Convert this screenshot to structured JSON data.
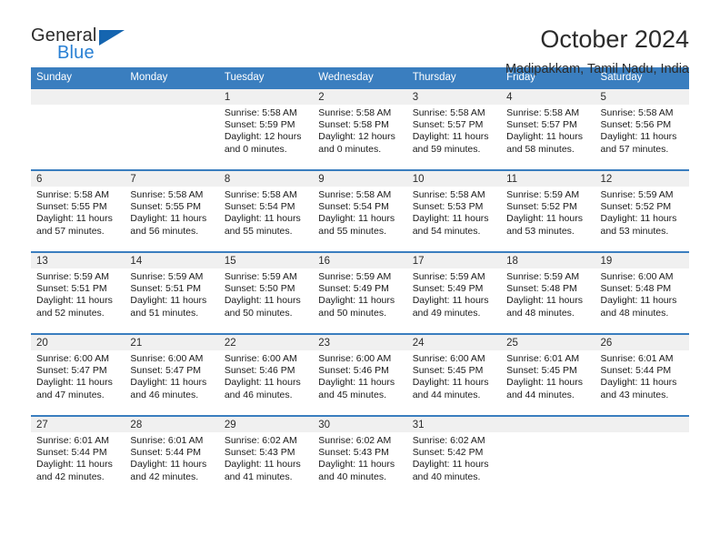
{
  "brand": {
    "name_part1": "General",
    "name_part2": "Blue",
    "triangle_color": "#1565b0",
    "blue_text_color": "#2980d4"
  },
  "header": {
    "title": "October 2024",
    "subtitle": "Madipakkam, Tamil Nadu, India"
  },
  "theme": {
    "header_row_bg": "#3a7ebf",
    "header_row_text": "#ffffff",
    "daynum_bg": "#f0f0f0",
    "grid_line": "#3a7ebf"
  },
  "weekday_headers": [
    "Sunday",
    "Monday",
    "Tuesday",
    "Wednesday",
    "Thursday",
    "Friday",
    "Saturday"
  ],
  "weeks": [
    [
      {
        "day": "",
        "sunrise": "",
        "sunset": "",
        "daylight": "",
        "empty": true
      },
      {
        "day": "",
        "sunrise": "",
        "sunset": "",
        "daylight": "",
        "empty": true
      },
      {
        "day": "1",
        "sunrise": "Sunrise: 5:58 AM",
        "sunset": "Sunset: 5:59 PM",
        "daylight": "Daylight: 12 hours and 0 minutes."
      },
      {
        "day": "2",
        "sunrise": "Sunrise: 5:58 AM",
        "sunset": "Sunset: 5:58 PM",
        "daylight": "Daylight: 12 hours and 0 minutes."
      },
      {
        "day": "3",
        "sunrise": "Sunrise: 5:58 AM",
        "sunset": "Sunset: 5:57 PM",
        "daylight": "Daylight: 11 hours and 59 minutes."
      },
      {
        "day": "4",
        "sunrise": "Sunrise: 5:58 AM",
        "sunset": "Sunset: 5:57 PM",
        "daylight": "Daylight: 11 hours and 58 minutes."
      },
      {
        "day": "5",
        "sunrise": "Sunrise: 5:58 AM",
        "sunset": "Sunset: 5:56 PM",
        "daylight": "Daylight: 11 hours and 57 minutes."
      }
    ],
    [
      {
        "day": "6",
        "sunrise": "Sunrise: 5:58 AM",
        "sunset": "Sunset: 5:55 PM",
        "daylight": "Daylight: 11 hours and 57 minutes."
      },
      {
        "day": "7",
        "sunrise": "Sunrise: 5:58 AM",
        "sunset": "Sunset: 5:55 PM",
        "daylight": "Daylight: 11 hours and 56 minutes."
      },
      {
        "day": "8",
        "sunrise": "Sunrise: 5:58 AM",
        "sunset": "Sunset: 5:54 PM",
        "daylight": "Daylight: 11 hours and 55 minutes."
      },
      {
        "day": "9",
        "sunrise": "Sunrise: 5:58 AM",
        "sunset": "Sunset: 5:54 PM",
        "daylight": "Daylight: 11 hours and 55 minutes."
      },
      {
        "day": "10",
        "sunrise": "Sunrise: 5:58 AM",
        "sunset": "Sunset: 5:53 PM",
        "daylight": "Daylight: 11 hours and 54 minutes."
      },
      {
        "day": "11",
        "sunrise": "Sunrise: 5:59 AM",
        "sunset": "Sunset: 5:52 PM",
        "daylight": "Daylight: 11 hours and 53 minutes."
      },
      {
        "day": "12",
        "sunrise": "Sunrise: 5:59 AM",
        "sunset": "Sunset: 5:52 PM",
        "daylight": "Daylight: 11 hours and 53 minutes."
      }
    ],
    [
      {
        "day": "13",
        "sunrise": "Sunrise: 5:59 AM",
        "sunset": "Sunset: 5:51 PM",
        "daylight": "Daylight: 11 hours and 52 minutes."
      },
      {
        "day": "14",
        "sunrise": "Sunrise: 5:59 AM",
        "sunset": "Sunset: 5:51 PM",
        "daylight": "Daylight: 11 hours and 51 minutes."
      },
      {
        "day": "15",
        "sunrise": "Sunrise: 5:59 AM",
        "sunset": "Sunset: 5:50 PM",
        "daylight": "Daylight: 11 hours and 50 minutes."
      },
      {
        "day": "16",
        "sunrise": "Sunrise: 5:59 AM",
        "sunset": "Sunset: 5:49 PM",
        "daylight": "Daylight: 11 hours and 50 minutes."
      },
      {
        "day": "17",
        "sunrise": "Sunrise: 5:59 AM",
        "sunset": "Sunset: 5:49 PM",
        "daylight": "Daylight: 11 hours and 49 minutes."
      },
      {
        "day": "18",
        "sunrise": "Sunrise: 5:59 AM",
        "sunset": "Sunset: 5:48 PM",
        "daylight": "Daylight: 11 hours and 48 minutes."
      },
      {
        "day": "19",
        "sunrise": "Sunrise: 6:00 AM",
        "sunset": "Sunset: 5:48 PM",
        "daylight": "Daylight: 11 hours and 48 minutes."
      }
    ],
    [
      {
        "day": "20",
        "sunrise": "Sunrise: 6:00 AM",
        "sunset": "Sunset: 5:47 PM",
        "daylight": "Daylight: 11 hours and 47 minutes."
      },
      {
        "day": "21",
        "sunrise": "Sunrise: 6:00 AM",
        "sunset": "Sunset: 5:47 PM",
        "daylight": "Daylight: 11 hours and 46 minutes."
      },
      {
        "day": "22",
        "sunrise": "Sunrise: 6:00 AM",
        "sunset": "Sunset: 5:46 PM",
        "daylight": "Daylight: 11 hours and 46 minutes."
      },
      {
        "day": "23",
        "sunrise": "Sunrise: 6:00 AM",
        "sunset": "Sunset: 5:46 PM",
        "daylight": "Daylight: 11 hours and 45 minutes."
      },
      {
        "day": "24",
        "sunrise": "Sunrise: 6:00 AM",
        "sunset": "Sunset: 5:45 PM",
        "daylight": "Daylight: 11 hours and 44 minutes."
      },
      {
        "day": "25",
        "sunrise": "Sunrise: 6:01 AM",
        "sunset": "Sunset: 5:45 PM",
        "daylight": "Daylight: 11 hours and 44 minutes."
      },
      {
        "day": "26",
        "sunrise": "Sunrise: 6:01 AM",
        "sunset": "Sunset: 5:44 PM",
        "daylight": "Daylight: 11 hours and 43 minutes."
      }
    ],
    [
      {
        "day": "27",
        "sunrise": "Sunrise: 6:01 AM",
        "sunset": "Sunset: 5:44 PM",
        "daylight": "Daylight: 11 hours and 42 minutes."
      },
      {
        "day": "28",
        "sunrise": "Sunrise: 6:01 AM",
        "sunset": "Sunset: 5:44 PM",
        "daylight": "Daylight: 11 hours and 42 minutes."
      },
      {
        "day": "29",
        "sunrise": "Sunrise: 6:02 AM",
        "sunset": "Sunset: 5:43 PM",
        "daylight": "Daylight: 11 hours and 41 minutes."
      },
      {
        "day": "30",
        "sunrise": "Sunrise: 6:02 AM",
        "sunset": "Sunset: 5:43 PM",
        "daylight": "Daylight: 11 hours and 40 minutes."
      },
      {
        "day": "31",
        "sunrise": "Sunrise: 6:02 AM",
        "sunset": "Sunset: 5:42 PM",
        "daylight": "Daylight: 11 hours and 40 minutes."
      },
      {
        "day": "",
        "sunrise": "",
        "sunset": "",
        "daylight": "",
        "empty": true
      },
      {
        "day": "",
        "sunrise": "",
        "sunset": "",
        "daylight": "",
        "empty": true
      }
    ]
  ]
}
